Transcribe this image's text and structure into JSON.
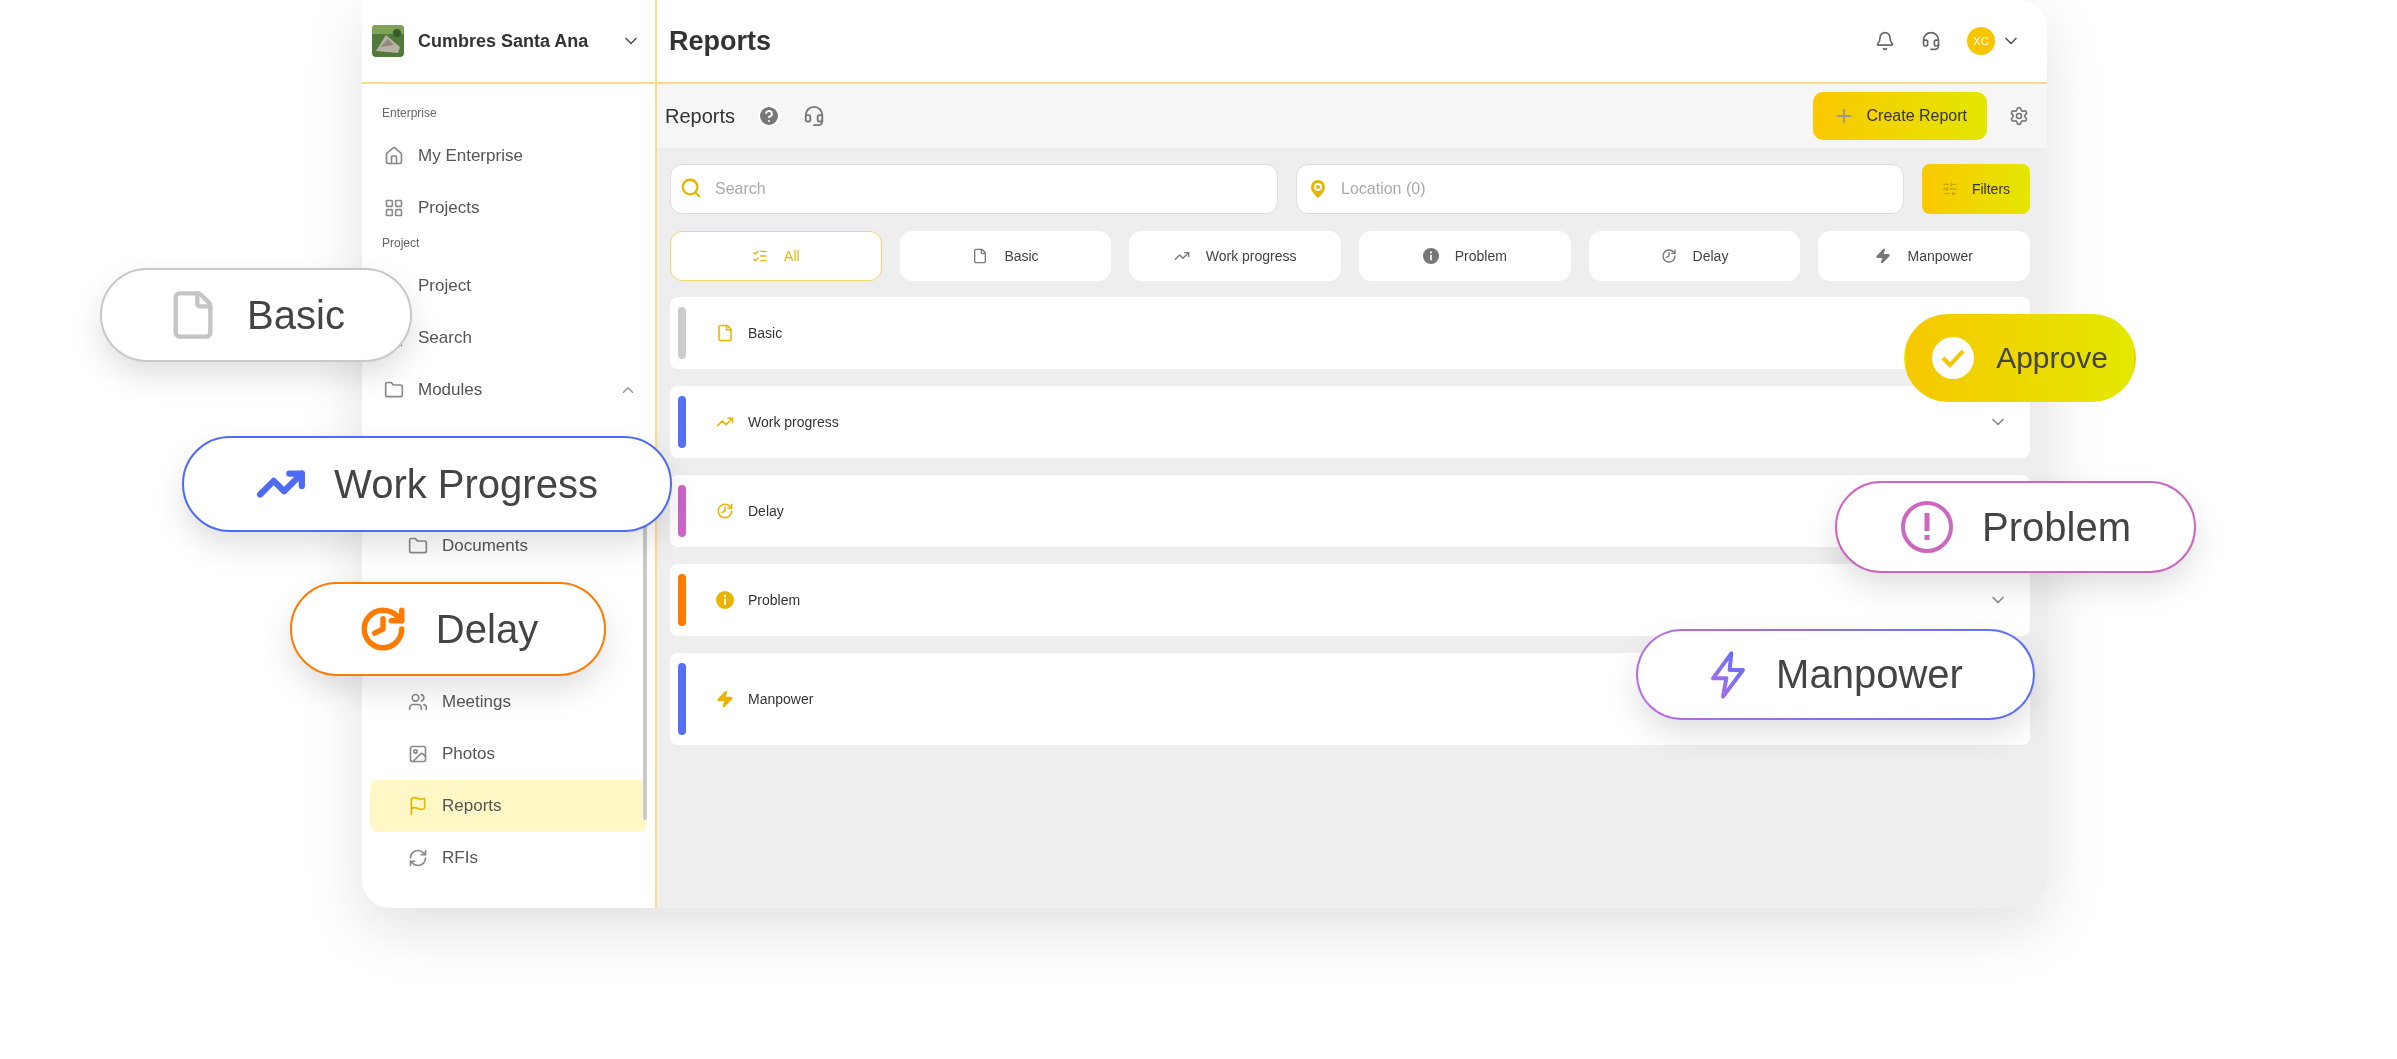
{
  "sidebar": {
    "project_name": "Cumbres Santa Ana",
    "sections": [
      {
        "label": "Enterprise",
        "items": [
          {
            "kind": "item",
            "label": "My Enterprise",
            "selected": false
          },
          {
            "kind": "item",
            "label": "Projects",
            "selected": false
          }
        ]
      },
      {
        "label": "Project",
        "items": [
          {
            "kind": "item",
            "label": "Project",
            "selected": false
          },
          {
            "kind": "item",
            "label": "Search",
            "selected": false
          },
          {
            "kind": "item",
            "label": "Modules",
            "selected": false,
            "expanded": true,
            "children": [
              {
                "kind": "covered"
              },
              {
                "kind": "covered"
              },
              {
                "kind": "item",
                "label": "Documents",
                "selected": false
              },
              {
                "kind": "covered"
              },
              {
                "kind": "covered"
              },
              {
                "kind": "item",
                "label": "Meetings",
                "selected": false
              },
              {
                "kind": "item",
                "label": "Photos",
                "selected": false
              },
              {
                "kind": "item",
                "label": "Reports",
                "selected": true
              },
              {
                "kind": "item",
                "label": "RFIs",
                "selected": false
              }
            ]
          }
        ]
      }
    ]
  },
  "header": {
    "title": "Reports",
    "avatar": "XC"
  },
  "toolbar": {
    "title": "Reports",
    "create_button": "Create Report"
  },
  "search": {
    "placeholder": "Search"
  },
  "location": {
    "placeholder": "Location (0)"
  },
  "filters_button": "Filters",
  "tabs": [
    {
      "label": "All",
      "selected": true
    },
    {
      "label": "Basic",
      "selected": false
    },
    {
      "label": "Work progress",
      "selected": false
    },
    {
      "label": "Problem",
      "selected": false
    },
    {
      "label": "Delay",
      "selected": false
    },
    {
      "label": "Manpower",
      "selected": false
    }
  ],
  "report_types": [
    {
      "label": "Basic",
      "color": "#cccccc",
      "chevron_shown": false
    },
    {
      "label": "Work progress",
      "color": "#5570f5",
      "chevron_shown": true
    },
    {
      "label": "Delay",
      "color": "#cc66c8",
      "chevron_shown": false
    },
    {
      "label": "Problem",
      "color": "#ff7a00",
      "chevron_shown": true
    },
    {
      "label": "Manpower",
      "color": "#5570f5",
      "chevron_shown": false
    }
  ],
  "callouts": [
    {
      "kind": "basic",
      "label": "Basic"
    },
    {
      "kind": "progress",
      "label": "Work Progress"
    },
    {
      "kind": "delay",
      "label": "Delay"
    },
    {
      "kind": "approve",
      "label": "Approve"
    },
    {
      "kind": "problem",
      "label": "Problem"
    },
    {
      "kind": "manpower",
      "label": "Manpower"
    }
  ]
}
